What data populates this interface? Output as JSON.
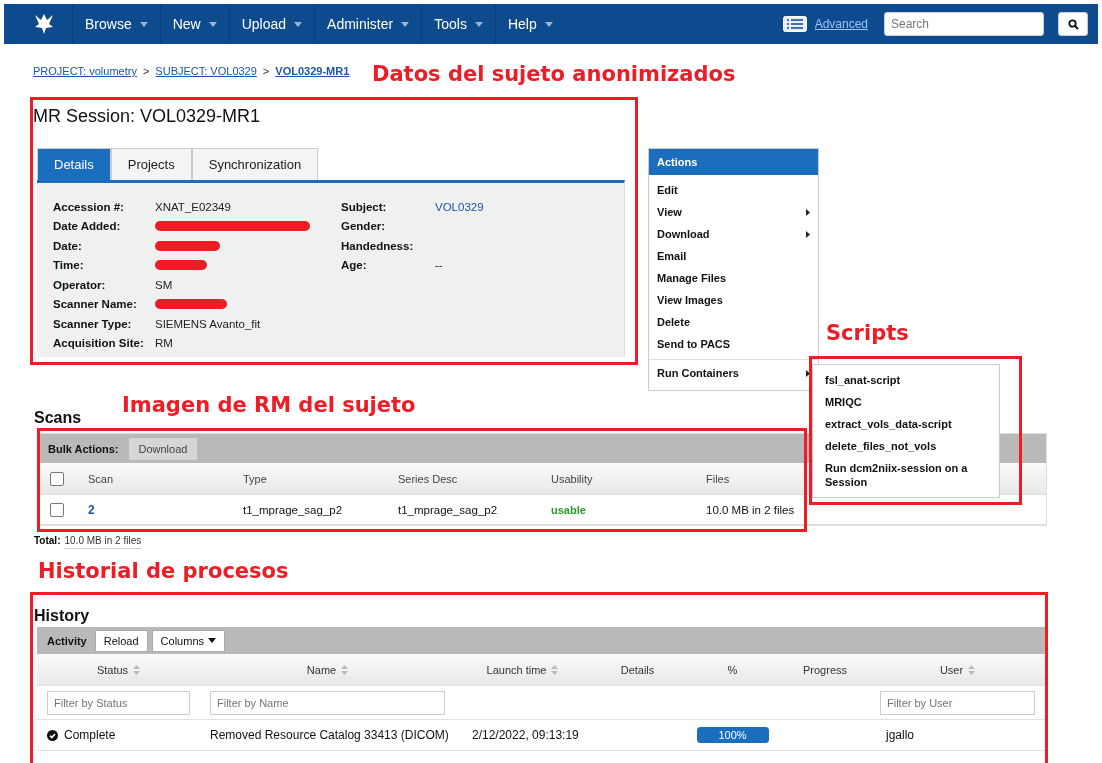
{
  "navbar": {
    "menus": [
      {
        "label": "Browse"
      },
      {
        "label": "New"
      },
      {
        "label": "Upload"
      },
      {
        "label": "Administer"
      },
      {
        "label": "Tools"
      },
      {
        "label": "Help"
      }
    ],
    "advanced_link": "Advanced",
    "search": {
      "placeholder": "Search"
    }
  },
  "breadcrumb": [
    {
      "label": "PROJECT: volumetry",
      "current": false
    },
    {
      "label": "SUBJECT: VOL0329",
      "current": false
    },
    {
      "label": "VOL0329-MR1",
      "current": true
    }
  ],
  "breadcrumb_separator": ">",
  "session": {
    "title": "MR Session: VOL0329-MR1",
    "tabs": [
      {
        "label": "Details",
        "selected": true
      },
      {
        "label": "Projects",
        "selected": false
      },
      {
        "label": "Synchronization",
        "selected": false
      }
    ],
    "fields_left": [
      {
        "label": "Accession #:",
        "value": "XNAT_E02349",
        "redacted": false
      },
      {
        "label": "Date Added:",
        "redacted": true
      },
      {
        "label": "Date:",
        "redacted": true
      },
      {
        "label": "Time:",
        "redacted": true
      },
      {
        "label": "Operator:",
        "value": "SM",
        "redacted": false
      },
      {
        "label": "Scanner Name:",
        "redacted": true
      },
      {
        "label": "Scanner Type:",
        "value": "SIEMENS Avanto_fit",
        "redacted": false
      },
      {
        "label": "Acquisition Site:",
        "value": "RM",
        "redacted": false
      }
    ],
    "fields_right": [
      {
        "label": "Subject:",
        "value": "VOL0329",
        "kind": "link"
      },
      {
        "label": "Gender:",
        "kind": "empty"
      },
      {
        "label": "Handedness:",
        "kind": "empty"
      },
      {
        "label": "Age:",
        "value": "--",
        "kind": "text"
      }
    ]
  },
  "actions_menu": {
    "title": "Actions",
    "items": [
      {
        "label": "Edit",
        "submenu": false,
        "separated": false
      },
      {
        "label": "View",
        "submenu": true,
        "separated": false
      },
      {
        "label": "Download",
        "submenu": true,
        "separated": false
      },
      {
        "label": "Email",
        "submenu": false,
        "separated": false
      },
      {
        "label": "Manage Files",
        "submenu": false,
        "separated": false
      },
      {
        "label": "View Images",
        "submenu": false,
        "separated": false
      },
      {
        "label": "Delete",
        "submenu": false,
        "separated": false
      },
      {
        "label": "Send to PACS",
        "submenu": false,
        "separated": false
      },
      {
        "label": "Run Containers",
        "submenu": true,
        "separated": true
      }
    ]
  },
  "scripts_menu": {
    "items": [
      {
        "label": "fsl_anat-script"
      },
      {
        "label": "MRIQC"
      },
      {
        "label": "extract_vols_data-script"
      },
      {
        "label": "delete_files_not_vols"
      },
      {
        "label": "Run dcm2niix-session on a Session"
      }
    ]
  },
  "scans": {
    "title": "Scans",
    "bulk_label": "Bulk Actions:",
    "bulk_button": "Download",
    "header_checked": false,
    "columns": [
      "Scan",
      "Type",
      "Series Desc",
      "Usability",
      "Files"
    ],
    "rows": [
      {
        "checked": false,
        "scan": "2",
        "type": "t1_mprage_sag_p2",
        "series_desc": "t1_mprage_sag_p2",
        "usability": "usable",
        "files": "10.0 MB in 2 files"
      }
    ],
    "total_label": "Total:",
    "total_value": "10.0 MB in 2 files"
  },
  "history": {
    "title": "History",
    "toolbar_label": "Activity",
    "reload_button": "Reload",
    "columns_button": "Columns",
    "columns": [
      {
        "label": "Status",
        "sortable": true,
        "filter_placeholder": "Filter by Status"
      },
      {
        "label": "Name",
        "sortable": true,
        "filter_placeholder": "Filter by Name"
      },
      {
        "label": "Launch time",
        "sortable": true
      },
      {
        "label": "Details",
        "sortable": false
      },
      {
        "label": "%",
        "sortable": false
      },
      {
        "label": "Progress",
        "sortable": false
      },
      {
        "label": "User",
        "sortable": true,
        "filter_placeholder": "Filter by User"
      }
    ],
    "rows": [
      {
        "status": "Complete",
        "name": "Removed Resource Catalog 33413 (DICOM)",
        "launch_time": "2/12/2022, 09:13:19",
        "percent": {
          "level": 1,
          "reading": "100%"
        },
        "user": "jgallo"
      }
    ]
  },
  "annotations": [
    {
      "label": "Datos del sujeto anonimizados"
    },
    {
      "label": "Scripts"
    },
    {
      "label": "Imagen de RM del sujeto"
    },
    {
      "label": "Historial de procesos"
    }
  ]
}
